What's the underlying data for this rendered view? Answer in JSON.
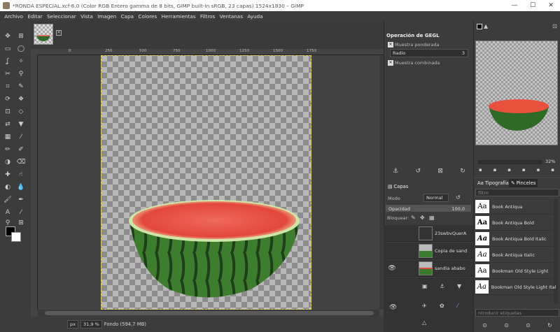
{
  "window": {
    "title": "*RONDA ESPECIAL.xcf-6.0 (Color RGB Entero gamma de 8 bits, GIMP built-in sRGB, 23 capas) 1524x1830 – GIMP",
    "minimize": "—",
    "maximize": "☐",
    "close": "✕"
  },
  "menu": [
    "Archivo",
    "Editar",
    "Seleccionar",
    "Vista",
    "Imagen",
    "Capa",
    "Colores",
    "Herramientas",
    "Filtros",
    "Ventanas",
    "Ayuda"
  ],
  "ruler": {
    "ticks": [
      "0",
      "250",
      "500",
      "750",
      "1000",
      "1250",
      "1500",
      "1750"
    ]
  },
  "status": {
    "unit": "px",
    "zoom": "31,9 %",
    "layer_info": "Fondo (594,7 MB)"
  },
  "gegl": {
    "title": "Operación de GEGL",
    "weighted_sample": "Muestra ponderada",
    "mode_value": "Radio",
    "mode_number": "3",
    "combined_sample": "Muestra combinada"
  },
  "navigator": {
    "zoom_percent": "32%"
  },
  "layers": {
    "tab_label": "Capas",
    "mode_label": "Modo",
    "mode_value": "Normal",
    "opacity_label": "Opacidad",
    "opacity_value": "100,0",
    "lock_label": "Bloquear:",
    "items": [
      {
        "name": "23swbvQuerA",
        "visible": false
      },
      {
        "name": "Copia de sand",
        "visible": false
      },
      {
        "name": "sandia ababo",
        "visible": true
      }
    ]
  },
  "fonts": {
    "tab_fonts": "Tipografías",
    "tab_brushes": "Pinceles",
    "filter_placeholder": "filtro",
    "tags_placeholder": "ntroducir etiquetas",
    "items": [
      "Book Antiqua",
      "Book Antiqua Bold",
      "Book Antiqua Bold Italic",
      "Book Antiqua Italic",
      "Bookman Old Style Light",
      "Bookman Old Style Light Italic"
    ]
  },
  "colors": {
    "fg": "#000000",
    "bg": "#ffffff",
    "selection": "#e6d94a"
  }
}
